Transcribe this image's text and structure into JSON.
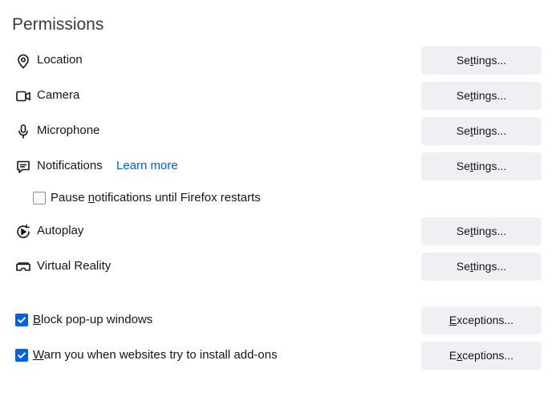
{
  "section": {
    "title": "Permissions"
  },
  "permissions": [
    {
      "label": "Location",
      "icon": "location-pin-icon",
      "button": "Settings..."
    },
    {
      "label": "Camera",
      "icon": "camera-icon",
      "button": "Settings..."
    },
    {
      "label": "Microphone",
      "icon": "microphone-icon",
      "button": "Settings..."
    },
    {
      "label": "Notifications",
      "icon": "notification-icon",
      "button": "Settings...",
      "link": "Learn more"
    },
    {
      "label": "Autoplay",
      "icon": "autoplay-icon",
      "button": "Settings..."
    },
    {
      "label": "Virtual Reality",
      "icon": "vr-headset-icon",
      "button": "Settings..."
    }
  ],
  "pause_notifications": {
    "label": "Pause notifications until Firefox restarts",
    "checked": false
  },
  "block_popups": {
    "label": "Block pop-up windows",
    "checked": true,
    "button": "Exceptions..."
  },
  "warn_addons": {
    "label": "Warn you when websites try to install add-ons",
    "checked": true,
    "button": "Exceptions..."
  },
  "colors": {
    "accent": "#0061e0",
    "button_bg": "#f0f0f4",
    "text": "#15141a"
  }
}
